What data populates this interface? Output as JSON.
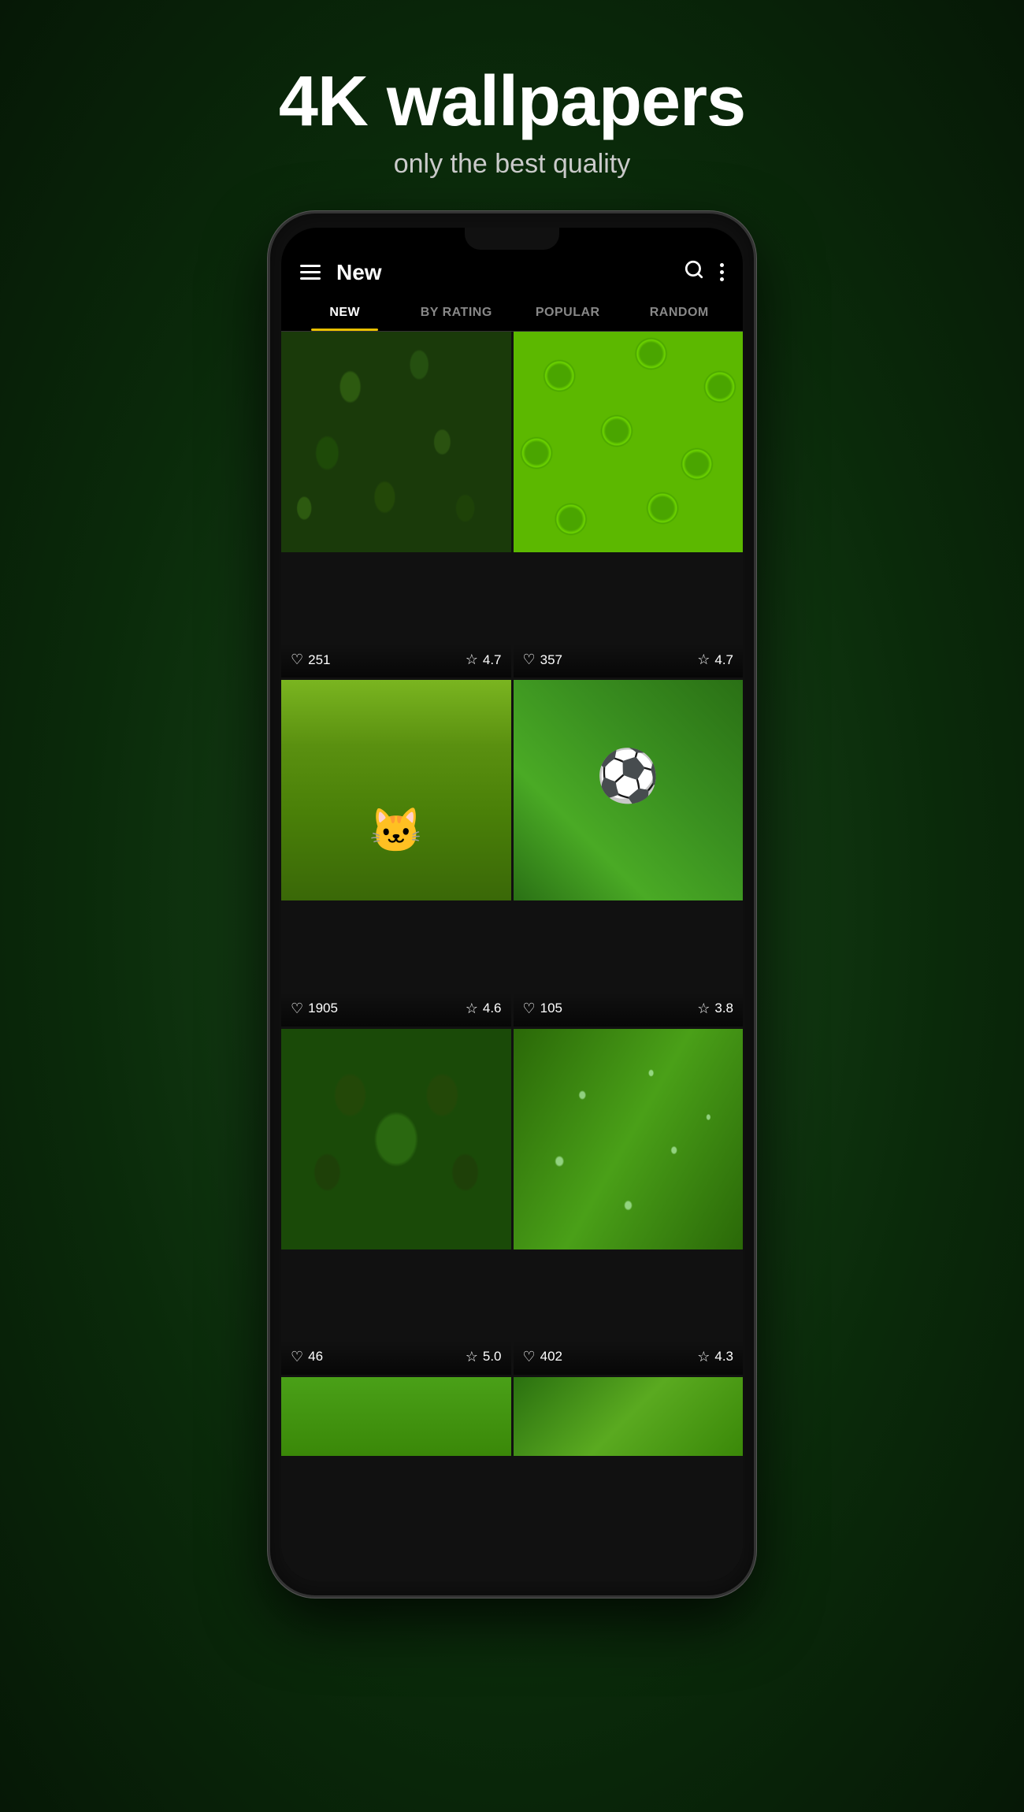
{
  "header": {
    "main_title": "4K wallpapers",
    "sub_title": "only the best quality"
  },
  "app": {
    "title": "New",
    "tabs": [
      {
        "label": "NEW",
        "active": true
      },
      {
        "label": "BY RATING",
        "active": false
      },
      {
        "label": "POPULAR",
        "active": false
      },
      {
        "label": "RANDOM",
        "active": false
      }
    ]
  },
  "wallpapers": [
    {
      "id": 1,
      "bg_class": "bg-leaves",
      "likes": "251",
      "rating": "4.7"
    },
    {
      "id": 2,
      "bg_class": "bg-limes",
      "likes": "357",
      "rating": "4.7"
    },
    {
      "id": 3,
      "bg_class": "bg-kitten",
      "likes": "1905",
      "rating": "4.6"
    },
    {
      "id": 4,
      "bg_class": "bg-soccer",
      "likes": "105",
      "rating": "3.8"
    },
    {
      "id": 5,
      "bg_class": "bg-plant",
      "likes": "46",
      "rating": "5.0"
    },
    {
      "id": 6,
      "bg_class": "bg-waterdrops",
      "likes": "402",
      "rating": "4.3"
    },
    {
      "id": 7,
      "bg_class": "bg-green-partial",
      "likes": "",
      "rating": ""
    },
    {
      "id": 8,
      "bg_class": "bg-green-partial",
      "likes": "",
      "rating": ""
    }
  ],
  "icons": {
    "hamburger": "☰",
    "search": "🔍",
    "heart": "♡",
    "star": "☆"
  }
}
